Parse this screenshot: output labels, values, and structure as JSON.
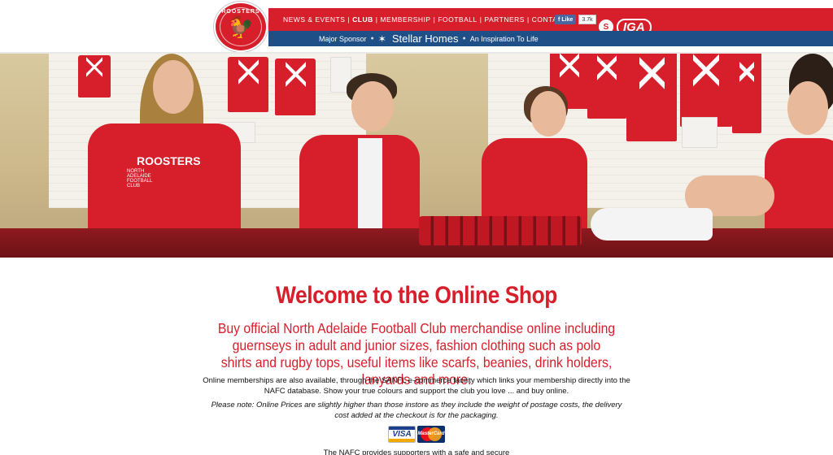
{
  "header": {
    "logo_text": "ROOSTERS",
    "nav": [
      {
        "label": "NEWS & EVENTS"
      },
      {
        "label": "CLUB"
      },
      {
        "label": "MEMBERSHIP"
      },
      {
        "label": "FOOTBALL"
      },
      {
        "label": "PARTNERS"
      },
      {
        "label": "CONTACT"
      }
    ],
    "nav_separator": "|",
    "facebook": {
      "label": "Like",
      "count": "3.7k"
    },
    "sponsor_badge": {
      "sanfl": "S",
      "iga": "IGA"
    },
    "sponsor_line": {
      "prefix": "Major Sponsor",
      "brand": "Stellar Homes",
      "tagline": "An Inspiration To Life"
    }
  },
  "hero": {
    "hoodie_text": "ROOSTERS",
    "hoodie_subtext": "NORTH ADELAIDE FOOTBALL CLUB"
  },
  "content": {
    "title": "Welcome to the Online Shop",
    "intro": "Buy official North Adelaide Football Club merchandise online including guernseys in adult and junior sizes, fashion clothing such as polo shirts and rugby tops, useful items like scarfs, beanies, drink holders, lanyards and more.",
    "paragraph1": "Online memberships are also available, through the SANFL e-commerce facility which links your membership directly into the NAFC database. Show your true colours and support the club you love ... and buy online.",
    "paragraph2": "Please note: Online Prices are slightly higher than those instore as they include the weight of postage costs, the delivery cost added at the checkout is for the packaging.",
    "cards": {
      "visa": "VISA",
      "mastercard": "MasterCard"
    },
    "paragraph3": "The NAFC provides supporters with a safe and secure"
  },
  "colors": {
    "brand_red": "#d71e2b",
    "sponsor_blue": "#1e4f87"
  }
}
